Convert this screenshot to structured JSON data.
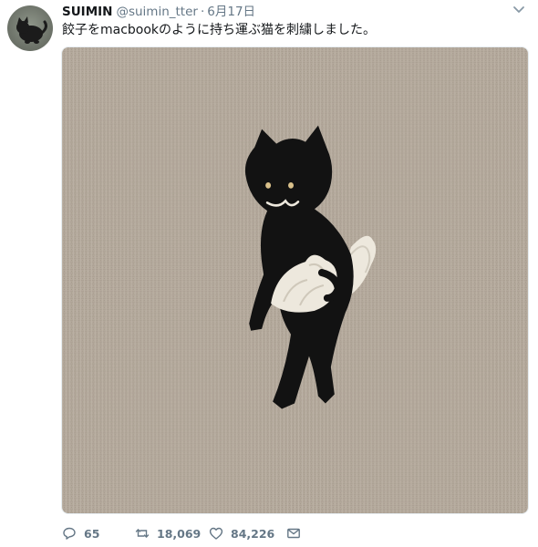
{
  "tweet": {
    "display_name": "SUIMIN",
    "handle": "@suimin_tter",
    "separator": "·",
    "date": "6月17日",
    "text": "餃子をmacbookのように持ち運ぶ猫を刺繍しました。"
  },
  "actions": {
    "reply_count": "65",
    "retweet_count": "18,069",
    "like_count": "84,226"
  },
  "icons": {
    "caret": "chevron-down-icon",
    "reply": "reply-icon",
    "retweet": "retweet-icon",
    "like": "heart-icon",
    "dm": "envelope-icon"
  },
  "colors": {
    "text": "#14171a",
    "muted": "#657786",
    "linen": "#b3a99b",
    "cat": "#121212",
    "thread_white": "#ede8dd"
  }
}
